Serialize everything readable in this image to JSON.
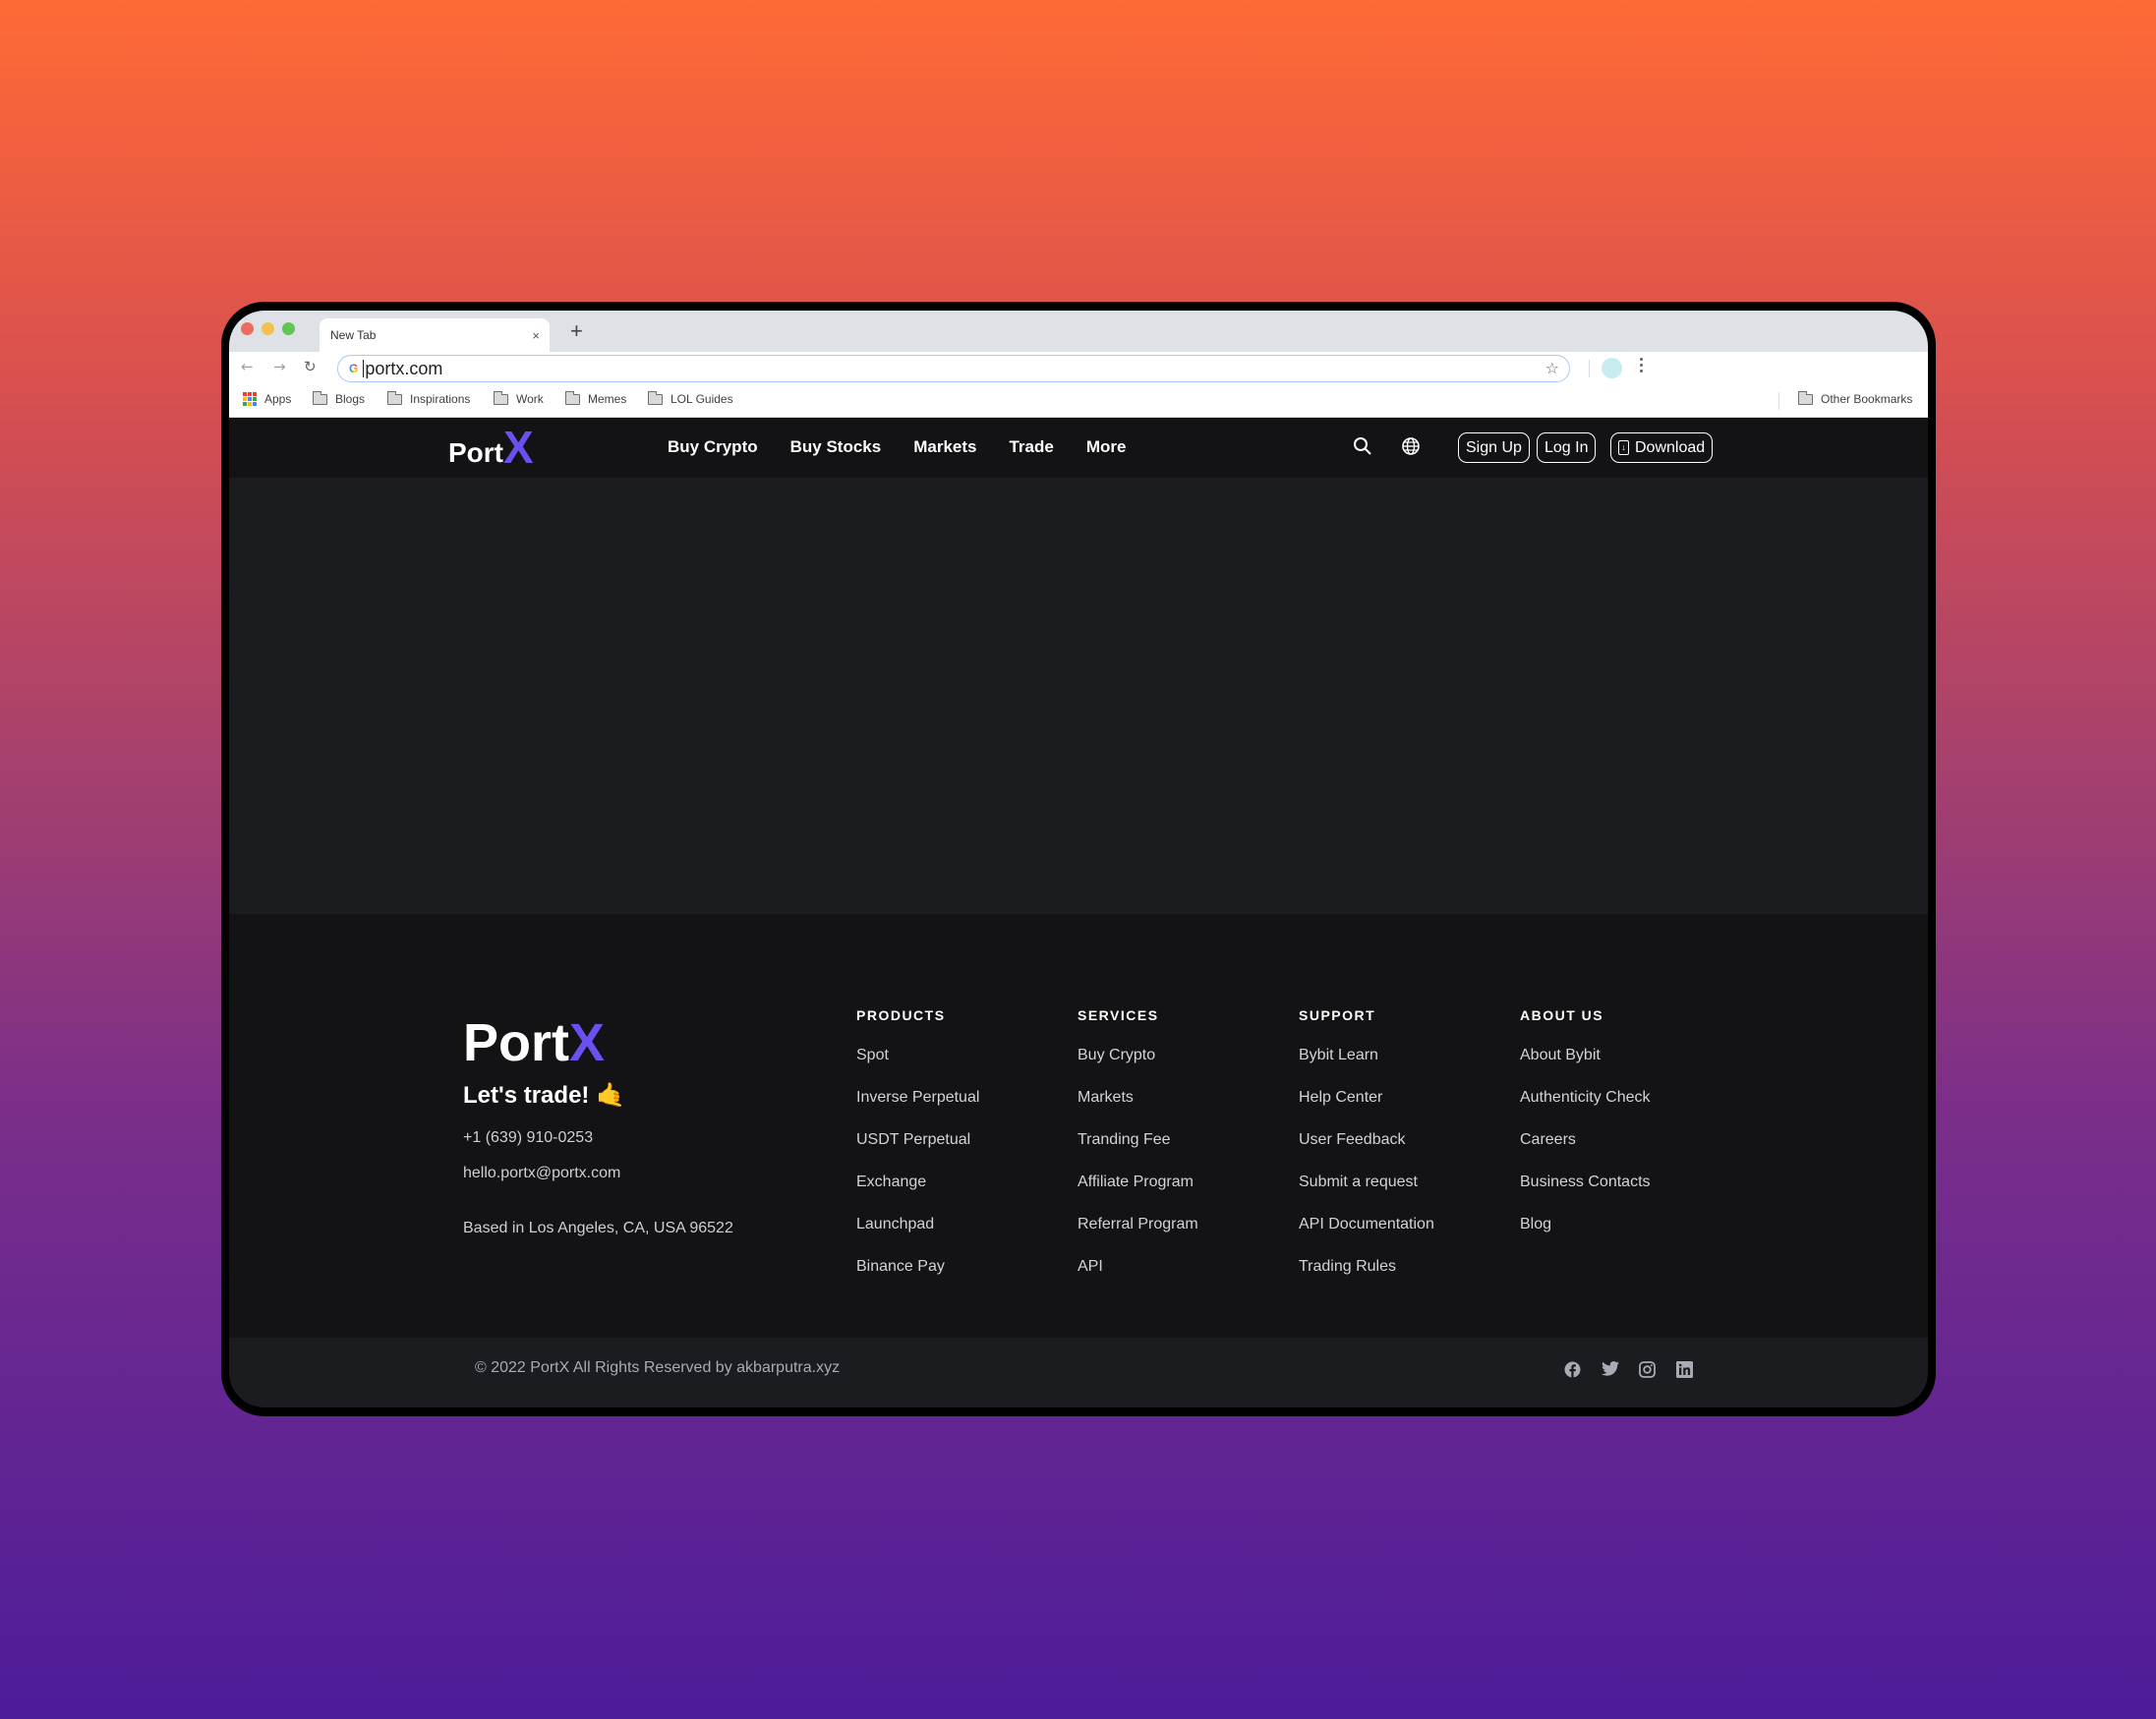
{
  "browser": {
    "tab_title": "New Tab",
    "tab_close": "×",
    "new_tab": "+",
    "url": "portx.com",
    "search_engine_icon": "G",
    "bookmarks": [
      "Apps",
      "Blogs",
      "Inspirations",
      "Work",
      "Memes",
      "LOL Guides"
    ],
    "other_bookmarks": "Other Bookmarks",
    "traffic_light_colors": [
      "#ed6a5e",
      "#f5bf4f",
      "#61c554"
    ]
  },
  "site": {
    "brand": {
      "name_main": "Port",
      "name_accent": "X",
      "accent_color": "#6a50f0"
    },
    "nav": {
      "items": [
        "Buy Crypto",
        "Buy Stocks",
        "Markets",
        "Trade",
        "More"
      ],
      "sign_up": "Sign Up",
      "log_in": "Log In",
      "download": "Download"
    },
    "footer": {
      "tagline": "Let's trade! 🤙",
      "phone": "+1  (639) 910-0253",
      "email": "hello.portx@portx.com",
      "address": "Based in Los Angeles, CA, USA 96522",
      "columns": [
        {
          "title": "PRODUCTS",
          "links": [
            "Spot",
            "Inverse Perpetual",
            "USDT Perpetual",
            "Exchange",
            "Launchpad",
            "Binance Pay"
          ]
        },
        {
          "title": "SERVICES",
          "links": [
            "Buy Crypto",
            "Markets",
            "Tranding Fee",
            "Affiliate Program",
            "Referral Program",
            "API"
          ]
        },
        {
          "title": "SUPPORT",
          "links": [
            "Bybit Learn",
            "Help Center",
            "User Feedback",
            "Submit a request",
            "API Documentation",
            "Trading Rules"
          ]
        },
        {
          "title": "ABOUT US",
          "links": [
            "About Bybit",
            "Authenticity Check",
            "Careers",
            "Business Contacts",
            "Blog"
          ]
        }
      ],
      "copyright": "© 2022 PortX All Rights Reserved by akbarputra.xyz",
      "social": [
        "facebook",
        "twitter",
        "instagram",
        "linkedin"
      ]
    }
  }
}
